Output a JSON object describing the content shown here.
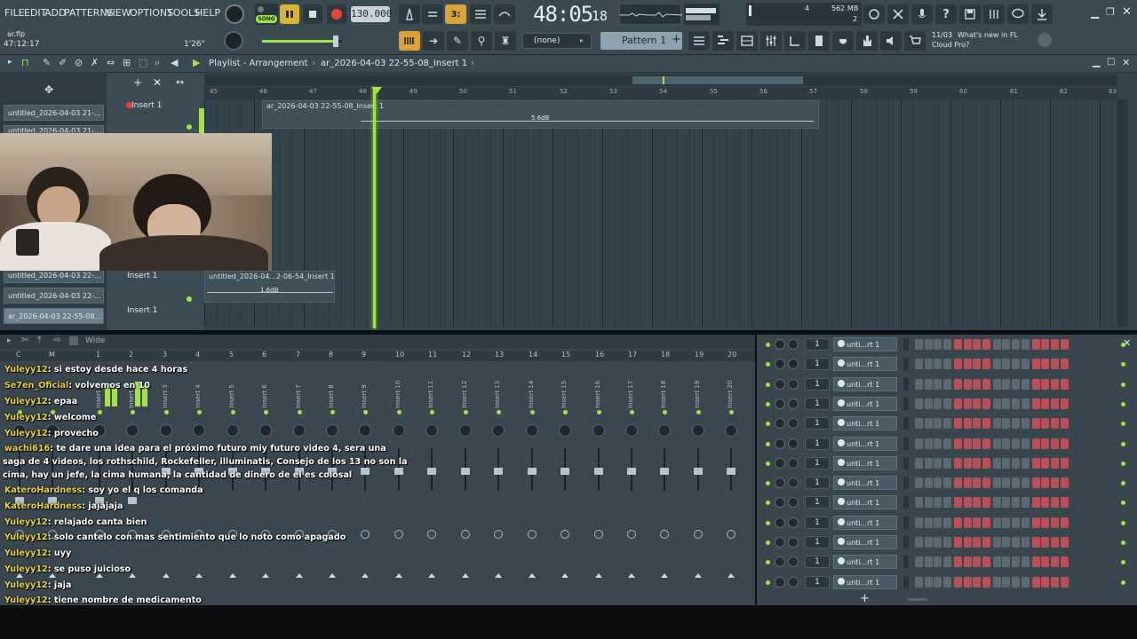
{
  "menu": [
    "FILE",
    "EDIT",
    "ADD",
    "PATTERNS",
    "VIEW",
    "OPTIONS",
    "TOOLS",
    "HELP"
  ],
  "file_name": "ar.flp",
  "file_time": "47:12:17",
  "file_len": "1'26\"",
  "song_label": "SONG",
  "tempo": "130.000",
  "time_display": {
    "main": "48:05",
    "sub": "18"
  },
  "cpu": {
    "top": "4",
    "mem": "562 MB",
    "poly": "2"
  },
  "pattern_selector": {
    "preset": "(none)",
    "pattern": "Pattern 1"
  },
  "news": {
    "date": "11/03",
    "text": "What's new in FL",
    "text2": "Cloud Pro?"
  },
  "playlist": {
    "title": "Playlist - Arrangement",
    "crumb": "ar_2026-04-03 22-55-08_Insert 1",
    "ruler": [
      "45",
      "46",
      "47",
      "48",
      "49",
      "50",
      "51",
      "52",
      "53",
      "54",
      "55",
      "56",
      "57",
      "58",
      "59",
      "60",
      "61",
      "62",
      "63"
    ],
    "patterns": [
      "untitled_2026-04-03 21-...",
      "untitled_2026-04-03 21-...",
      "untitled_2026-04-03 22-...",
      "untitled_2026-04-03 22-...",
      "ar_2026-04-03 22-55-08..."
    ],
    "tracks": [
      "Insert 1",
      "Insert 1",
      "Insert 1"
    ],
    "clips": [
      {
        "title": "ar_2026-04-03 22-55-08_Insert 1",
        "gain": "5.6dB"
      },
      {
        "title": "untitled_2026-04...2-06-54_Insert 1",
        "gain": "1.6dB"
      }
    ]
  },
  "mixer": {
    "mode": "Wide",
    "numbers": [
      "C",
      "M",
      "1",
      "2",
      "3",
      "4",
      "5",
      "6",
      "7",
      "8",
      "9",
      "10",
      "11",
      "12",
      "13",
      "14",
      "15",
      "16",
      "17",
      "18",
      "19",
      "20"
    ],
    "inserts": [
      "Insert 1",
      "Insert 2",
      "Insert 3",
      "Insert 4",
      "Insert 5",
      "Insert 6",
      "Insert 7",
      "Insert 8",
      "Insert 9",
      "Insert 10",
      "Insert 11",
      "Insert 12",
      "Insert 13",
      "Insert 14",
      "Insert 15",
      "Insert 16",
      "Insert 17",
      "Insert 18",
      "Insert 19",
      "Insert 20"
    ]
  },
  "rack": {
    "rows": [
      {
        "num": "1",
        "name": "unti...rt 1"
      },
      {
        "num": "1",
        "name": "unti...rt 1"
      },
      {
        "num": "1",
        "name": "unti...rt 1"
      },
      {
        "num": "1",
        "name": "unti...rt 1"
      },
      {
        "num": "1",
        "name": "unti...rt 1"
      },
      {
        "num": "1",
        "name": "unti...rt 1"
      },
      {
        "num": "1",
        "name": "unti...rt 1"
      },
      {
        "num": "1",
        "name": "unti...rt 1"
      },
      {
        "num": "1",
        "name": "unti...rt 1"
      },
      {
        "num": "1",
        "name": "unti...rt 1"
      },
      {
        "num": "1",
        "name": "unti...rt 1"
      },
      {
        "num": "1",
        "name": "unti...rt 1"
      },
      {
        "num": "1",
        "name": "unti...rt 1"
      }
    ],
    "add": "+"
  },
  "chat": [
    {
      "user": "Yuleyy12",
      "msg": ": si estoy desde hace 4 horas"
    },
    {
      "user": "Se7en_Oficial",
      "msg": ": volvemos en 10"
    },
    {
      "user": "Yuleyy12",
      "msg": ": epaa"
    },
    {
      "user": "Yuleyy12",
      "msg": ": welcome"
    },
    {
      "user": "Yuleyy12",
      "msg": ": provecho"
    },
    {
      "user": "wachi616",
      "msg": ": te dare una idea para el próximo futuro miy futuro video 4, sera una"
    },
    {
      "user": "",
      "msg": "saga de 4 videos, los rothschild, Rockefeller, illuminatis, Consejo de los 13 no son la"
    },
    {
      "user": "",
      "msg": "cima, hay un jefe, la cima humana, la cantidad de dinero de el es colosal"
    },
    {
      "user": "KateroHardness",
      "msg": ": soy yo el q los comanda"
    },
    {
      "user": "KateroHardness",
      "msg": ": jajajaja"
    },
    {
      "user": "Yuleyy12",
      "msg": ": relajado canta bien"
    },
    {
      "user": "Yuleyy12",
      "msg": ": solo cantelo con mas sentimiento que lo noto como apagado"
    },
    {
      "user": "Yuleyy12",
      "msg": ": uyy"
    },
    {
      "user": "Yuleyy12",
      "msg": ": se puso juicioso"
    },
    {
      "user": "Yuleyy12",
      "msg": ": jaja"
    },
    {
      "user": "Yuleyy12",
      "msg": ": tiene nombre de medicamento"
    }
  ],
  "colors": {
    "accent": "#a4e24a",
    "step_on": "#b8505a",
    "step_off": "#5b6a72",
    "chat_user": "#e8d33a",
    "bg": "#3b4951"
  }
}
